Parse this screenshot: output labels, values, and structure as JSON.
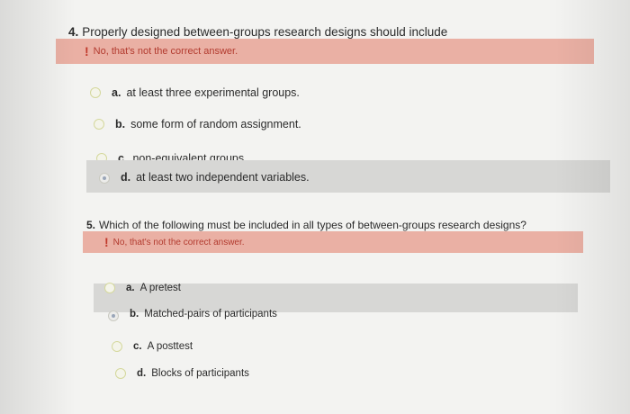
{
  "questions": [
    {
      "number": "4.",
      "text": "Properly designed between-groups research designs should include",
      "feedback_mark": "!",
      "feedback": "No, that's not the correct answer.",
      "options": [
        {
          "letter": "a.",
          "text": "at least three experimental groups.",
          "selected": false
        },
        {
          "letter": "b.",
          "text": "some form of random assignment.",
          "selected": false
        },
        {
          "letter": "c.",
          "text": "non-equivalent groups.",
          "selected": false
        },
        {
          "letter": "d.",
          "text": "at least two independent variables.",
          "selected": true
        }
      ]
    },
    {
      "number": "5.",
      "text": "Which of the following must be included in all types of between-groups research designs?",
      "feedback_mark": "!",
      "feedback": "No, that's not the correct answer.",
      "options": [
        {
          "letter": "a.",
          "text": "A pretest",
          "selected": false
        },
        {
          "letter": "b.",
          "text": "Matched-pairs of participants",
          "selected": true
        },
        {
          "letter": "c.",
          "text": "A posttest",
          "selected": false
        },
        {
          "letter": "d.",
          "text": "Blocks of participants",
          "selected": false
        }
      ]
    }
  ]
}
